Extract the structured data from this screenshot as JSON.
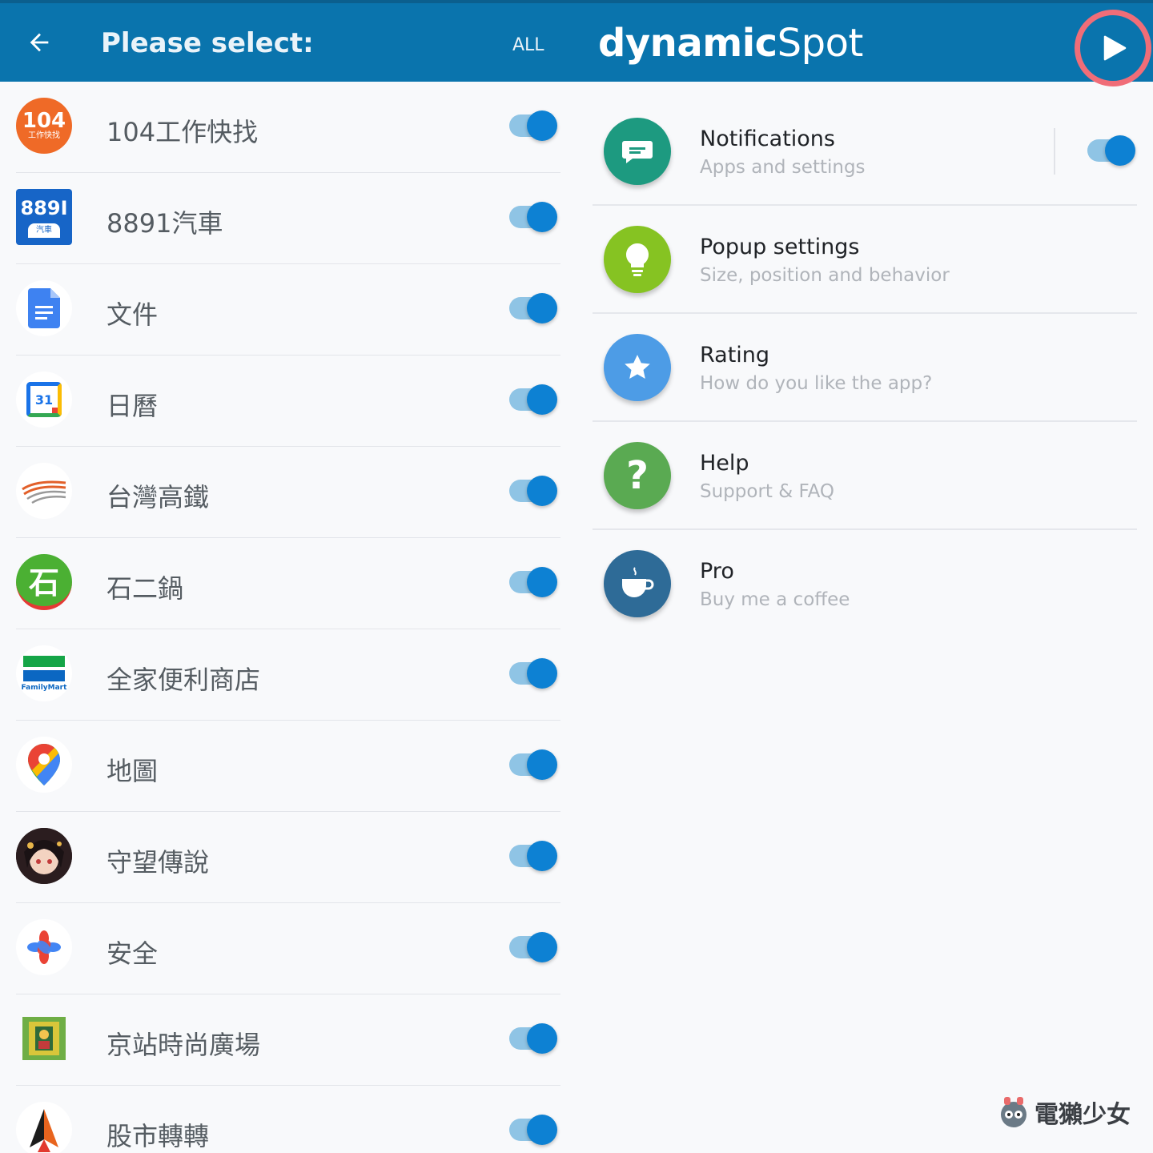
{
  "left_header": {
    "title": "Please select:",
    "all_label": "ALL",
    "back_icon": "arrow-left-icon"
  },
  "apps": [
    {
      "name": "104工作快找",
      "icon": "app-104-icon",
      "icon_text": "104",
      "icon_sub": "工作快找",
      "enabled": true
    },
    {
      "name": "8891汽車",
      "icon": "app-8891-icon",
      "icon_text": "889I",
      "icon_sub": "汽車",
      "enabled": true
    },
    {
      "name": "文件",
      "icon": "google-docs-icon",
      "enabled": true
    },
    {
      "name": "日曆",
      "icon": "google-calendar-icon",
      "icon_text": "31",
      "enabled": true
    },
    {
      "name": "台灣高鐵",
      "icon": "thsr-icon",
      "enabled": true
    },
    {
      "name": "石二鍋",
      "icon": "shi-er-guo-icon",
      "icon_text": "石",
      "enabled": true
    },
    {
      "name": "全家便利商店",
      "icon": "familymart-icon",
      "icon_text": "FamilyMart",
      "enabled": true
    },
    {
      "name": "地圖",
      "icon": "google-maps-icon",
      "enabled": true
    },
    {
      "name": "守望傳說",
      "icon": "guardian-tales-icon",
      "enabled": true
    },
    {
      "name": "安全",
      "icon": "safety-icon",
      "enabled": true
    },
    {
      "name": "京站時尚廣場",
      "icon": "qsquare-icon",
      "enabled": true
    },
    {
      "name": "股市轉轉",
      "icon": "stock-app-icon",
      "enabled": true
    }
  ],
  "right_header": {
    "brand_bold": "dynamic",
    "brand_light": "Spot",
    "play_icon": "play-icon"
  },
  "settings": [
    {
      "title": "Notifications",
      "subtitle": "Apps and settings",
      "icon": "message-icon",
      "color": "#1d9a80",
      "has_toggle": true,
      "enabled": true
    },
    {
      "title": "Popup settings",
      "subtitle": "Size, position and behavior",
      "icon": "lightbulb-icon",
      "color": "#86c322"
    },
    {
      "title": "Rating",
      "subtitle": "How do you like the app?",
      "icon": "star-icon",
      "color": "#4d9ce6"
    },
    {
      "title": "Help",
      "subtitle": "Support & FAQ",
      "icon": "question-icon",
      "color": "#5aaa52",
      "icon_text": "?"
    },
    {
      "title": "Pro",
      "subtitle": "Buy me a coffee",
      "icon": "coffee-icon",
      "color": "#2e6b97"
    }
  ],
  "watermark": {
    "text": "電獺少女",
    "icon": "otter-logo-icon"
  },
  "colors": {
    "header": "#0a74ad",
    "toggle_on": "#0d81d3",
    "highlight_ring": "#f06d78"
  }
}
